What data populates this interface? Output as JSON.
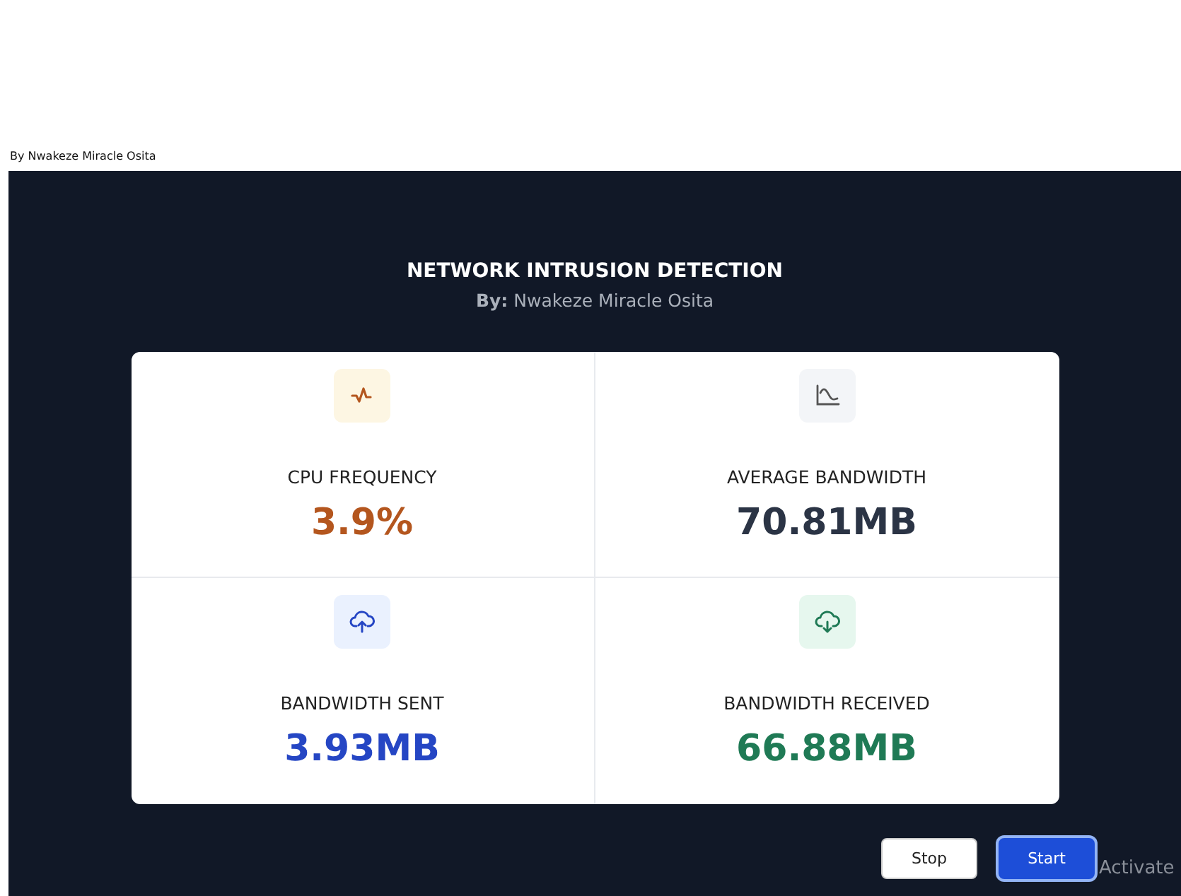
{
  "caption": "By Nwakeze Miracle Osita",
  "header": {
    "title": "NETWORK INTRUSION DETECTION",
    "byline_label": "By:",
    "byline_name": "Nwakeze Miracle Osita"
  },
  "stats": [
    {
      "kind": "pulse",
      "label": "CPU FREQUENCY",
      "value": "3.9%",
      "color": "#b4561e"
    },
    {
      "kind": "chart",
      "label": "AVERAGE BANDWIDTH",
      "value": "70.81MB",
      "color": "#2b3445"
    },
    {
      "kind": "upload",
      "label": "BANDWIDTH SENT",
      "value": "3.93MB",
      "color": "#2546c4"
    },
    {
      "kind": "download",
      "label": "BANDWIDTH RECEIVED",
      "value": "66.88MB",
      "color": "#1f7a55"
    }
  ],
  "buttons": [
    {
      "label": "Stop",
      "kind": "secondary",
      "focused": false
    },
    {
      "label": "Start",
      "kind": "primary",
      "focused": true
    }
  ],
  "os_notice": "Activate"
}
